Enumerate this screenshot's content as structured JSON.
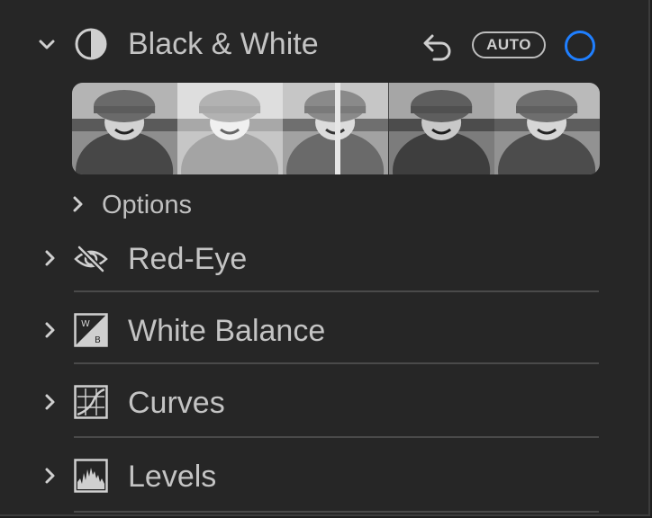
{
  "black_white": {
    "title": "Black & White",
    "auto_label": "AUTO",
    "expanded": true,
    "toggle_color": "#1f7fff",
    "icon": "half-circle-icon"
  },
  "thumbnail_strip": {
    "thumbnail_count": 5,
    "has_split_preview": true
  },
  "options": {
    "label": "Options"
  },
  "sections": [
    {
      "title": "Red-Eye",
      "icon": "eye-slash-icon"
    },
    {
      "title": "White Balance",
      "icon": "white-balance-icon"
    },
    {
      "title": "Curves",
      "icon": "curves-icon"
    },
    {
      "title": "Levels",
      "icon": "levels-icon"
    }
  ]
}
